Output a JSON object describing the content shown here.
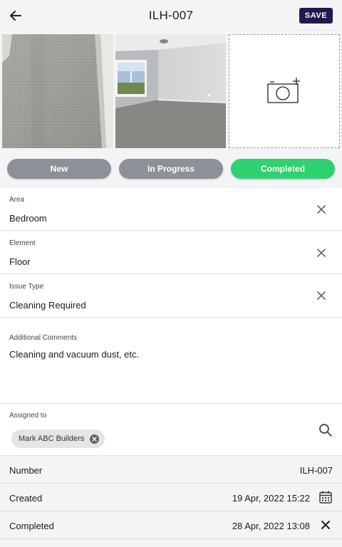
{
  "header": {
    "title": "ILH-007",
    "back_icon": "arrow-left-icon",
    "save_label": "SAVE",
    "save_color": "#1f1a4f"
  },
  "photos": {
    "items": [
      {
        "name": "carpet-close-up-photo"
      },
      {
        "name": "bedroom-room-photo"
      }
    ],
    "add_icon": "camera-plus-icon"
  },
  "status": {
    "options": [
      {
        "label": "New",
        "active": false,
        "color": "#8e9097"
      },
      {
        "label": "In Progress",
        "active": false,
        "color": "#8e9097"
      },
      {
        "label": "Completed",
        "active": true,
        "color": "#2ed36f"
      }
    ]
  },
  "fields": {
    "area": {
      "label": "Area",
      "value": "Bedroom"
    },
    "element": {
      "label": "Element",
      "value": "Floor"
    },
    "issue_type": {
      "label": "Issue Type",
      "value": "Cleaning Required"
    },
    "comments": {
      "label": "Additional Comments",
      "value": "Cleaning and vacuum dust, etc."
    }
  },
  "assigned": {
    "label": "Assigned to",
    "chip": "Mark ABC Builders",
    "search_icon": "search-icon"
  },
  "info": {
    "number": {
      "label": "Number",
      "value": "ILH-007"
    },
    "created": {
      "label": "Created",
      "value": "19 Apr, 2022 15:22",
      "icon": "calendar-icon"
    },
    "completed": {
      "label": "Completed",
      "value": "28 Apr, 2022 13:08",
      "icon": "close-icon"
    }
  }
}
